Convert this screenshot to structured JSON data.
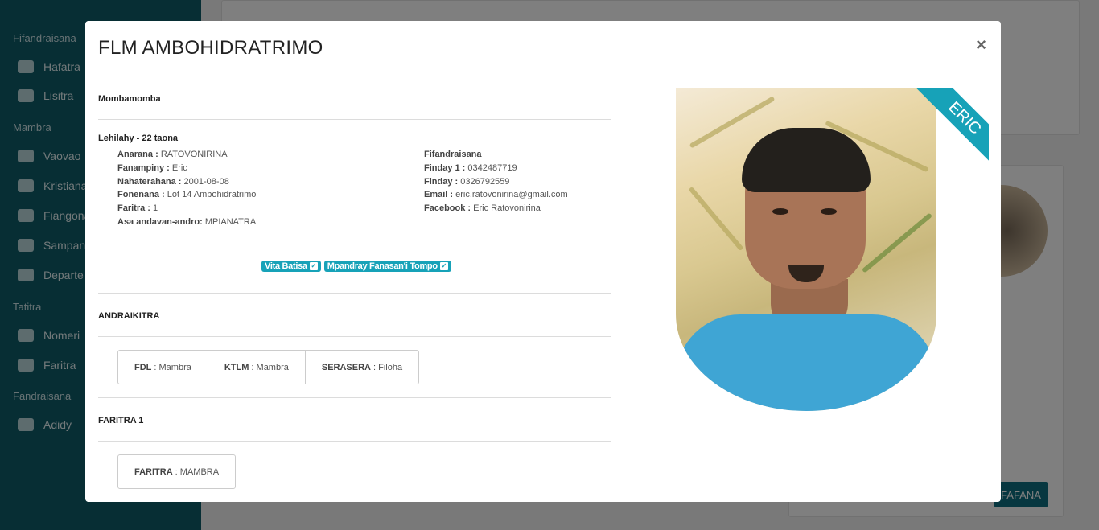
{
  "sidebar": {
    "sections": [
      "Fifandraisana",
      "Mambra",
      "Tatitra",
      "Fandraisana"
    ],
    "items": [
      {
        "label": "Hafatra",
        "icon": "envelope-icon"
      },
      {
        "label": "Lisitra",
        "icon": "phone-icon"
      },
      {
        "label": "Vaovao",
        "icon": "plus-icon"
      },
      {
        "label": "Kristiana",
        "icon": "user-icon"
      },
      {
        "label": "Fiangona",
        "icon": "home-icon"
      },
      {
        "label": "Sampana",
        "icon": "cubes-icon"
      },
      {
        "label": "Departe",
        "icon": "list-icon"
      },
      {
        "label": "Nomeri",
        "icon": "tree-icon"
      },
      {
        "label": "Faritra",
        "icon": "map-icon"
      },
      {
        "label": "Adidy",
        "icon": "hand-icon"
      }
    ]
  },
  "background": {
    "button_label": "FAFANA"
  },
  "modal": {
    "title": "FLM AMBOHIDRATRIMO",
    "close": "×",
    "section_mombamomba": "Mombamomba",
    "gender_age": "Lehilahy - 22 taona",
    "personal": [
      {
        "label": "Anarana :",
        "value": "RATOVONIRINA"
      },
      {
        "label": "Fanampiny :",
        "value": "Eric"
      },
      {
        "label": "Nahaterahana :",
        "value": "2001-08-08"
      },
      {
        "label": "Fonenana :",
        "value": "Lot 14 Ambohidratrimo"
      },
      {
        "label": "Faritra :",
        "value": "1"
      },
      {
        "label": "Asa andavan-andro:",
        "value": "MPIANATRA"
      }
    ],
    "contact_title": "Fifandraisana",
    "contact": [
      {
        "label": "Finday 1 :",
        "value": "0342487719"
      },
      {
        "label": "Finday :",
        "value": "0326792559"
      },
      {
        "label": "Email :",
        "value": "eric.ratovonirina@gmail.com"
      },
      {
        "label": "Facebook :",
        "value": "Eric Ratovonirina"
      }
    ],
    "badges": [
      "Vita Batisa",
      "Mpandray Fanasan'i Tompo"
    ],
    "andraikitra_title": "ANDRAIKITRA",
    "andraikitra": [
      {
        "label": "FDL",
        "value": "Mambra"
      },
      {
        "label": "KTLM",
        "value": "Mambra"
      },
      {
        "label": "SERASERA",
        "value": "Filoha"
      }
    ],
    "faritra_title": "FARITRA 1",
    "faritra": [
      {
        "label": "FARITRA",
        "value": "MAMBRA"
      }
    ],
    "ribbon": "ERIC"
  }
}
